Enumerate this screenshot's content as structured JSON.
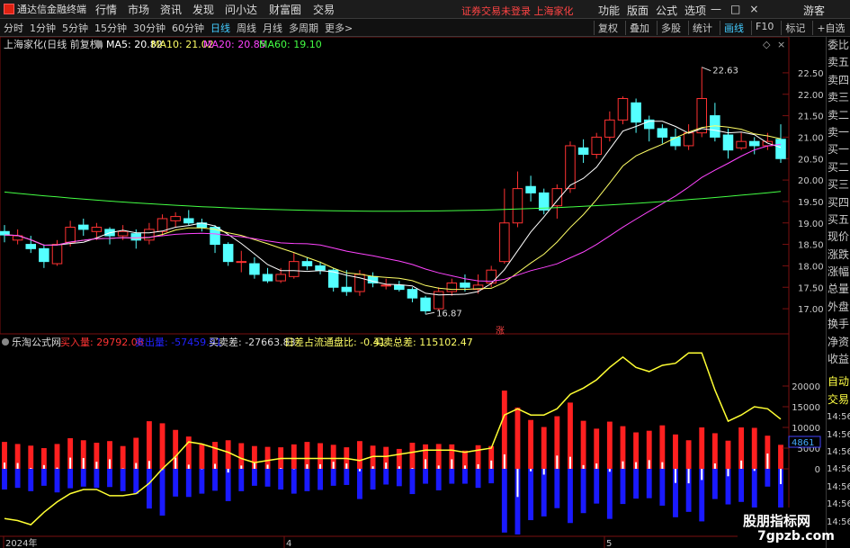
{
  "menubar": {
    "app_title": "通达信金融终端",
    "items": [
      "行情",
      "市场",
      "资讯",
      "发现",
      "问小达",
      "财富圈",
      "交易"
    ],
    "notice": "证券交易未登录  上海家化",
    "right_items": [
      "功能",
      "版面",
      "公式",
      "选项"
    ],
    "window_controls": [
      "—",
      "□",
      "×"
    ],
    "guest": "游客"
  },
  "toolbar": {
    "periods": [
      "分时",
      "1分钟",
      "5分钟",
      "15分钟",
      "30分钟",
      "60分钟",
      "日线",
      "周线",
      "月线",
      "多周期",
      "更多>"
    ],
    "active_period": "日线",
    "tools": [
      "复权",
      "叠加",
      "多股",
      "统计",
      "画线",
      "F10",
      "标记",
      "+自选"
    ],
    "active_tool": "画线"
  },
  "main_chart": {
    "stock": "上海家化(日线 前复权)",
    "ma": [
      {
        "label": "MA5: 20.82",
        "color": "#ffffff"
      },
      {
        "label": "MA10: 21.02",
        "color": "#ffff66"
      },
      {
        "label": "MA20: 20.85",
        "color": "#ff44ff"
      },
      {
        "label": "MA60: 19.10",
        "color": "#44ff44"
      }
    ],
    "y_ticks": [
      "22.50",
      "22.00",
      "21.50",
      "21.00",
      "20.50",
      "20.00",
      "19.50",
      "19.00",
      "18.50",
      "18.00",
      "17.50",
      "17.00"
    ],
    "high_label": "22.63",
    "low_label": "16.87",
    "zhang_label": "涨"
  },
  "sub_chart": {
    "name": "乐淘公式网",
    "buy_label": "买入量: 29792.08",
    "sell_label": "卖出量: -57459.91",
    "diff_label": "买卖差: -27663.83",
    "ratio_label": "日差占流通盘比: -0.41",
    "total_label": "买卖总差: 115102.47",
    "y_ticks": [
      "20000",
      "15000",
      "10000",
      "5000",
      "0"
    ],
    "current_value": "4861"
  },
  "x_axis": [
    "2024年",
    "4",
    "5"
  ],
  "side_panel": {
    "top_labels": [
      "委比",
      "卖五",
      "卖四",
      "卖三",
      "卖二",
      "卖一",
      "买一",
      "买二",
      "买三",
      "买四",
      "买五",
      "现价",
      "涨跌",
      "涨幅",
      "总量",
      "外盘",
      "换手",
      "净资",
      "收益"
    ],
    "bottom_labels": [
      "自动",
      "交易"
    ],
    "times": [
      "14:56",
      "14:56",
      "14:56",
      "14:56",
      "14:56",
      "14:56",
      "14:56",
      "14:56",
      "14:56"
    ]
  },
  "watermark": {
    "line1": "股朋指标网",
    "line2": "7gpzb.com"
  },
  "chart_data": {
    "type": "candlestick",
    "candles": [
      [
        18.8,
        18.72,
        18.95,
        18.55
      ],
      [
        18.6,
        18.7,
        18.85,
        18.5
      ],
      [
        18.5,
        18.4,
        18.7,
        18.3
      ],
      [
        18.4,
        18.1,
        18.5,
        17.95
      ],
      [
        18.05,
        18.5,
        18.6,
        18.0
      ],
      [
        18.55,
        18.9,
        19.05,
        18.45
      ],
      [
        18.95,
        18.85,
        19.1,
        18.7
      ],
      [
        18.8,
        18.9,
        19.0,
        18.6
      ],
      [
        18.85,
        18.7,
        18.9,
        18.5
      ],
      [
        18.7,
        18.8,
        18.95,
        18.6
      ],
      [
        18.75,
        18.6,
        18.85,
        18.4
      ],
      [
        18.6,
        18.85,
        19.0,
        18.5
      ],
      [
        18.8,
        19.1,
        19.2,
        18.7
      ],
      [
        19.05,
        19.15,
        19.25,
        18.9
      ],
      [
        19.1,
        19.0,
        19.3,
        18.95
      ],
      [
        19.0,
        18.9,
        19.1,
        18.8
      ],
      [
        18.9,
        18.5,
        18.95,
        18.3
      ],
      [
        18.5,
        18.1,
        18.55,
        18.0
      ],
      [
        18.1,
        18.1,
        18.35,
        17.85
      ],
      [
        18.05,
        17.8,
        18.2,
        17.7
      ],
      [
        17.8,
        17.65,
        17.95,
        17.6
      ],
      [
        17.65,
        17.8,
        17.95,
        17.6
      ],
      [
        17.75,
        18.1,
        18.3,
        17.7
      ],
      [
        18.1,
        18.0,
        18.2,
        17.9
      ],
      [
        18.0,
        17.9,
        18.1,
        17.8
      ],
      [
        17.9,
        17.5,
        17.95,
        17.4
      ],
      [
        17.5,
        17.4,
        17.9,
        17.3
      ],
      [
        17.4,
        17.8,
        17.9,
        17.3
      ],
      [
        17.75,
        17.6,
        17.85,
        17.5
      ],
      [
        17.55,
        17.55,
        17.7,
        17.45
      ],
      [
        17.55,
        17.45,
        17.65,
        17.4
      ],
      [
        17.45,
        17.25,
        17.5,
        17.15
      ],
      [
        17.25,
        16.95,
        17.3,
        16.87
      ],
      [
        17.0,
        17.4,
        17.5,
        16.95
      ],
      [
        17.4,
        17.6,
        17.7,
        17.3
      ],
      [
        17.6,
        17.5,
        17.8,
        17.4
      ],
      [
        17.45,
        17.55,
        17.8,
        17.35
      ],
      [
        17.6,
        17.9,
        18.0,
        17.5
      ],
      [
        18.1,
        19.0,
        19.8,
        18.05
      ],
      [
        19.0,
        19.8,
        20.2,
        18.9
      ],
      [
        19.85,
        19.7,
        20.1,
        19.5
      ],
      [
        19.7,
        19.3,
        19.8,
        19.2
      ],
      [
        19.4,
        19.8,
        19.9,
        19.1
      ],
      [
        19.8,
        20.8,
        20.9,
        19.7
      ],
      [
        20.75,
        20.6,
        20.95,
        20.4
      ],
      [
        20.6,
        21.0,
        21.1,
        20.5
      ],
      [
        21.0,
        21.4,
        21.6,
        20.9
      ],
      [
        21.4,
        21.9,
        21.95,
        21.3
      ],
      [
        21.8,
        21.35,
        21.9,
        21.1
      ],
      [
        21.4,
        21.2,
        21.5,
        20.9
      ],
      [
        21.2,
        21.0,
        21.3,
        20.85
      ],
      [
        21.0,
        20.8,
        21.2,
        20.7
      ],
      [
        20.8,
        21.1,
        21.3,
        20.7
      ],
      [
        21.1,
        21.9,
        22.63,
        21.0
      ],
      [
        21.5,
        21.0,
        21.8,
        20.9
      ],
      [
        21.05,
        20.7,
        21.2,
        20.5
      ],
      [
        20.75,
        20.9,
        21.1,
        20.7
      ],
      [
        20.9,
        20.8,
        21.0,
        20.6
      ],
      [
        20.8,
        20.9,
        21.1,
        20.7
      ],
      [
        20.95,
        20.5,
        21.3,
        20.4
      ]
    ],
    "buy_volumes": [
      6500,
      6000,
      5600,
      5000,
      6000,
      7400,
      6900,
      6300,
      6700,
      5500,
      7500,
      11500,
      11000,
      9400,
      7800,
      5900,
      6500,
      6900,
      6200,
      5500,
      5300,
      5200,
      5900,
      6500,
      6200,
      5800,
      5200,
      6700,
      5600,
      5300,
      4800,
      6300,
      5900,
      6000,
      5900,
      4400,
      5700,
      5500,
      18900,
      14800,
      11800,
      10100,
      12700,
      16000,
      11600,
      9700,
      11400,
      10300,
      8800,
      9200,
      10500,
      8300,
      6900,
      10000,
      8600,
      6800,
      10000,
      9900,
      8000,
      5800
    ],
    "sell_volumes": [
      -5000,
      -4600,
      -5400,
      -4100,
      -5700,
      -4700,
      -4300,
      -4600,
      -4400,
      -5400,
      -6100,
      -9600,
      -11300,
      -6700,
      -6800,
      -6000,
      -5300,
      -7800,
      -5400,
      -4100,
      -4300,
      -5000,
      -6000,
      -5400,
      -5100,
      -4100,
      -3900,
      -7300,
      -5000,
      -3800,
      -4200,
      -6100,
      -3600,
      -5200,
      -3600,
      -3600,
      -4600,
      -3500,
      -15400,
      -21600,
      -12400,
      -11500,
      -9500,
      -13100,
      -10700,
      -8400,
      -12100,
      -8500,
      -7200,
      -7100,
      -8900,
      -11700,
      -10400,
      -12700,
      -7300,
      -8600,
      -8000,
      -10400,
      -4300,
      -9500
    ],
    "total_diff": [
      -12000,
      -12500,
      -13500,
      -10500,
      -8000,
      -6000,
      -5000,
      -5000,
      -6500,
      -6500,
      -6000,
      -3500,
      0,
      3000,
      6500,
      6000,
      5000,
      4000,
      2500,
      1500,
      2000,
      2500,
      2500,
      2500,
      2500,
      2500,
      2500,
      2000,
      3000,
      3000,
      3500,
      4000,
      4500,
      4500,
      4500,
      4000,
      4500,
      5000,
      13000,
      14500,
      13000,
      13000,
      14500,
      18000,
      19500,
      21500,
      24500,
      27000,
      24500,
      23500,
      25000,
      25500,
      28000,
      28000,
      19000,
      11500,
      13000,
      15000,
      14500,
      12000
    ]
  }
}
